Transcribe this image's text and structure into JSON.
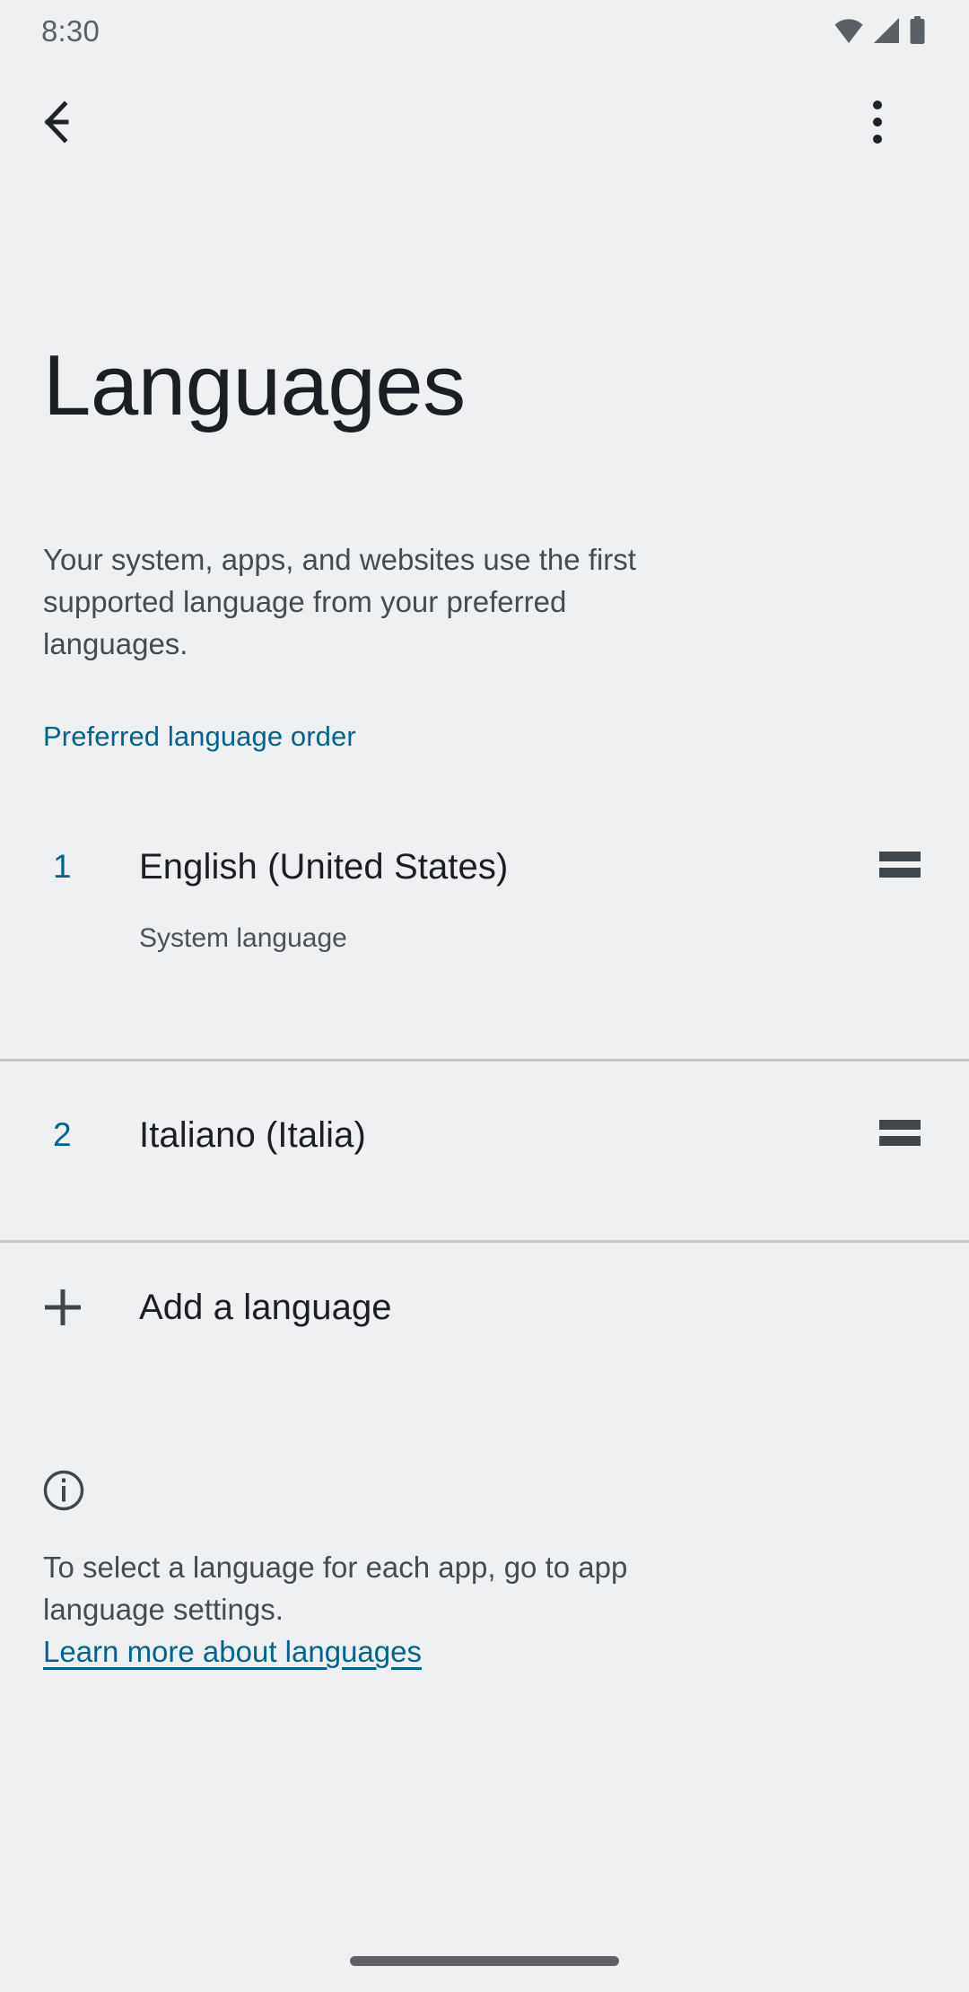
{
  "status_bar": {
    "time": "8:30",
    "icons": [
      "wifi-icon",
      "cellular-signal-icon",
      "battery-icon"
    ]
  },
  "action_bar": {
    "back_icon": "back-arrow-icon",
    "overflow_icon": "more-vert-icon"
  },
  "header": {
    "title": "Languages",
    "description": "Your system, apps, and websites use the first supported language from your preferred languages."
  },
  "section": {
    "label": "Preferred language order"
  },
  "languages": [
    {
      "index": "1",
      "name": "English (United States)",
      "subtitle": "System language",
      "drag_icon": "drag-handle-icon"
    },
    {
      "index": "2",
      "name": "Italiano (Italia)",
      "subtitle": "",
      "drag_icon": "drag-handle-icon"
    }
  ],
  "add_language": {
    "label": "Add a language",
    "icon": "plus-icon"
  },
  "footer": {
    "icon": "info-outline-icon",
    "text": "To select a language for each app, go to app language settings.",
    "link": "Learn more about languages"
  },
  "colors": {
    "background": "#eff0f2",
    "accent": "#00638f",
    "primary_text": "#1b1e22",
    "secondary_text": "#454b52",
    "divider": "#c6c7ca",
    "icon": "#3f464c",
    "nav_pill": "#5f6164"
  }
}
